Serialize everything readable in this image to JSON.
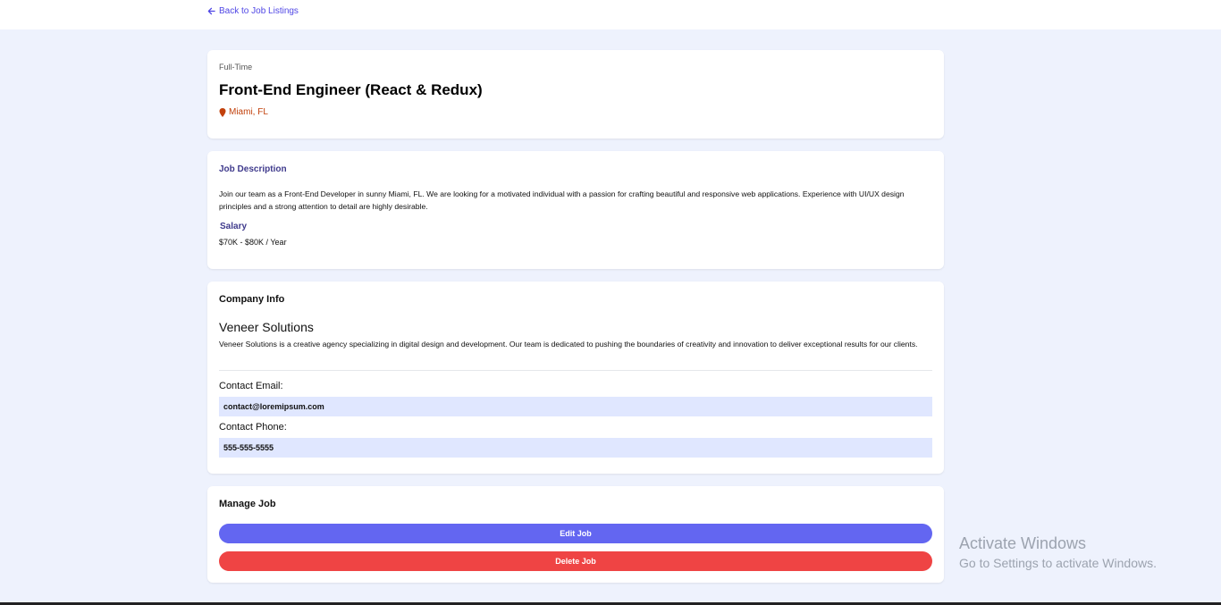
{
  "nav": {
    "back_label": "Back to Job Listings"
  },
  "job": {
    "type": "Full-Time",
    "title": "Front-End Engineer (React & Redux)",
    "location": "Miami, FL"
  },
  "description": {
    "heading": "Job Description",
    "text": "Join our team as a Front-End Developer in sunny Miami, FL. We are looking for a motivated individual with a passion for crafting beautiful and responsive web applications. Experience with UI/UX design principles and a strong attention to detail are highly desirable.",
    "salary_heading": "Salary",
    "salary_value": "$70K - $80K / Year"
  },
  "company": {
    "heading": "Company Info",
    "name": "Veneer Solutions",
    "description": "Veneer Solutions is a creative agency specializing in digital design and development. Our team is dedicated to pushing the boundaries of creativity and innovation to deliver exceptional results for our clients.",
    "email_label": "Contact Email:",
    "email_value": "contact@loremipsum.com",
    "phone_label": "Contact Phone:",
    "phone_value": "555-555-5555"
  },
  "manage": {
    "heading": "Manage Job",
    "edit_label": "Edit Job",
    "delete_label": "Delete Job"
  },
  "watermark": {
    "title": "Activate Windows",
    "subtitle": "Go to Settings to activate Windows."
  },
  "colors": {
    "accent": "#6366f1",
    "danger": "#ef4444",
    "location": "#c2410c",
    "background": "#eef2fd",
    "field_bg": "#e0e7ff"
  },
  "icons": {
    "back": "arrow-left-icon",
    "location": "map-marker-icon"
  }
}
